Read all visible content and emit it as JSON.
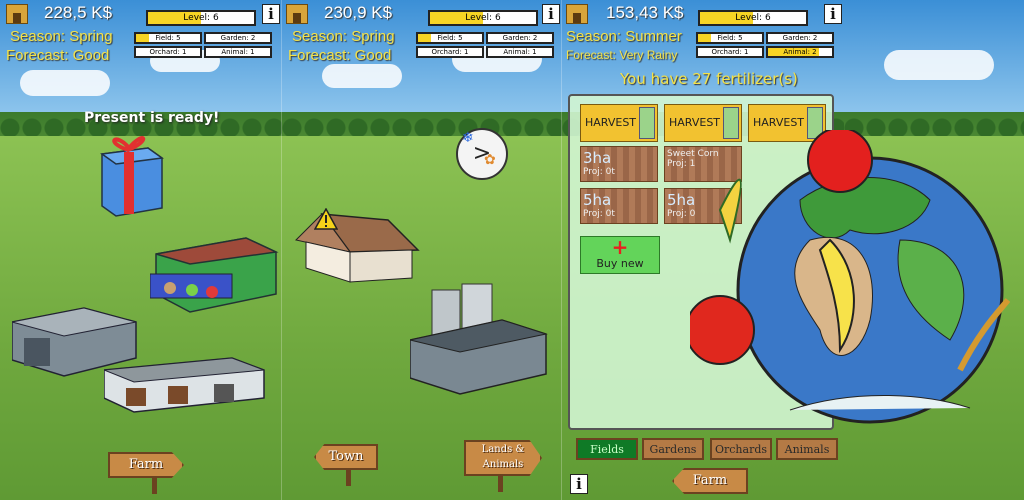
{
  "panels": [
    {
      "money": "228,5 K$",
      "season": "Season: Spring",
      "forecast": "Forecast: Good",
      "level": "Level: 6",
      "level_progress": 0.5,
      "info": "i",
      "present": "Present is ready!",
      "sign": "Farm",
      "stats": {
        "field": "Field: 5",
        "garden": "Garden: 2",
        "orchard": "Orchard: 1",
        "animal": "Animal: 1",
        "field_progress": 0.2,
        "garden_progress": 0.0,
        "orchard_progress": 0.0,
        "animal_progress": 0.0
      }
    },
    {
      "money": "230,9 K$",
      "season": "Season: Spring",
      "forecast": "Forecast: Good",
      "level": "Level: 6",
      "level_progress": 0.5,
      "info": "i",
      "season_dial": ">",
      "signs": [
        "Town",
        "Lands & Animals"
      ],
      "stats": {
        "field": "Field: 5",
        "garden": "Garden: 2",
        "orchard": "Orchard: 1",
        "animal": "Animal: 1",
        "field_progress": 0.2,
        "garden_progress": 0.0,
        "orchard_progress": 0.0,
        "animal_progress": 0.0
      }
    },
    {
      "money": "153,43 K$",
      "season": "Season: Summer",
      "forecast": "Forecast: Very Rainy",
      "level": "Level: 6",
      "level_progress": 0.5,
      "info": "i",
      "fertilizer": "You have 27 fertilizer(s)",
      "stats": {
        "field": "Field: 5",
        "garden": "Garden: 2",
        "orchard": "Orchard: 1",
        "animal": "Animal: 2",
        "field_progress": 0.2,
        "garden_progress": 0.0,
        "orchard_progress": 0.0,
        "animal_progress": 0.8
      },
      "harvest_buttons": [
        "HARVEST",
        "HARVEST",
        "HARVEST"
      ],
      "tiles": [
        {
          "size": "3ha",
          "proj": "Proj: 0t"
        },
        {
          "size": "",
          "proj": "Proj: 1",
          "crop": "Sweet Corn"
        },
        {
          "size": "5ha",
          "proj": "Proj: 0t"
        },
        {
          "size": "5ha",
          "proj": "Proj: 0"
        }
      ],
      "buy": "Buy new",
      "tabs": [
        "Fields",
        "Gardens",
        "Orchards",
        "Animals"
      ],
      "active_tab": "Fields",
      "sign": "Farm"
    }
  ],
  "colors": {
    "money_text": "#ffffff",
    "season_text": "#f3e24a",
    "level_fill": "#f7d424",
    "active_tab": "#0f7a26",
    "harvest": "#f2c230",
    "buy": "#63d45a"
  }
}
